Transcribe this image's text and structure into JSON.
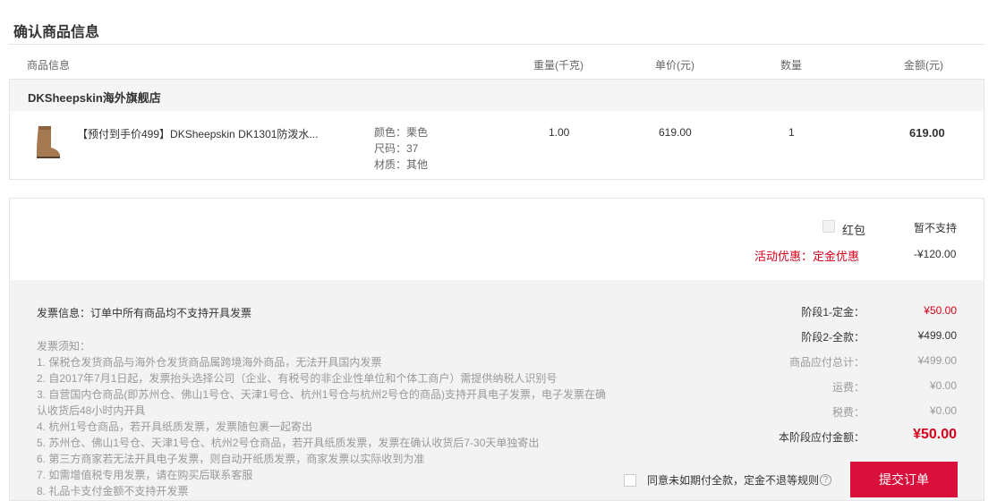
{
  "page": {
    "title": "确认商品信息"
  },
  "columns": {
    "product": "商品信息",
    "weight": "重量(千克)",
    "unit_price": "单价(元)",
    "quantity": "数量",
    "amount": "金额(元)"
  },
  "shop": {
    "name": "DKSheepskin海外旗舰店"
  },
  "item": {
    "name": "【预付到手价499】DKSheepskin DK1301防泼水...",
    "attrs": [
      "颜色：栗色",
      "尺码：37",
      "材质：其他"
    ],
    "weight": "1.00",
    "unit_price": "619.00",
    "quantity": "1",
    "amount": "619.00",
    "image_color": "#a57a52"
  },
  "promo": {
    "hongbao_label": "红包",
    "hongbao_value": "暂不支持",
    "activity_label": "活动优惠：定金优惠",
    "activity_value": "-¥120.00"
  },
  "invoice": {
    "info": "发票信息：订单中所有商品均不支持开具发票",
    "notes": [
      "发票须知：",
      "1. 保税仓发货商品与海外仓发货商品属跨境海外商品，无法开具国内发票",
      "2. 自2017年7月1日起，发票抬头选择公司（企业、有税号的非企业性单位和个体工商户）需提供纳税人识别号",
      "3. 自营国内仓商品(即苏州仓、佛山1号仓、天津1号仓、杭州1号仓与杭州2号仓的商品)支持开具电子发票，电子发票在确",
      "认收货后48小时内开具",
      "4. 杭州1号仓商品，若开具纸质发票，发票随包裹一起寄出",
      "5. 苏州仓、佛山1号仓、天津1号仓、杭州2号仓商品，若开具纸质发票，发票在确认收货后7-30天单独寄出",
      "6. 第三方商家若无法开具电子发票，则自动开纸质发票，商家发票以实际收到为准",
      "7. 如需增值税专用发票，请在购买后联系客服",
      "8. 礼品卡支付金额不支持开发票"
    ]
  },
  "summary": {
    "stage1_label": "阶段1-定金：",
    "stage1_value": "¥50.00",
    "stage2_label": "阶段2-全款：",
    "stage2_value": "¥499.00",
    "total_label": "商品应付总计：",
    "total_value": "¥499.00",
    "shipping_label": "运费：",
    "shipping_value": "¥0.00",
    "tax_label": "税费：",
    "tax_value": "¥0.00",
    "due_label": "本阶段应付金额：",
    "due_value": "¥50.00"
  },
  "agreement": {
    "text": "同意未如期付全款，定金不退等规则",
    "help_icon": "?"
  },
  "submit": {
    "label": "提交订单"
  },
  "colors": {
    "accent": "#d9001b",
    "button": "#d9103c"
  }
}
